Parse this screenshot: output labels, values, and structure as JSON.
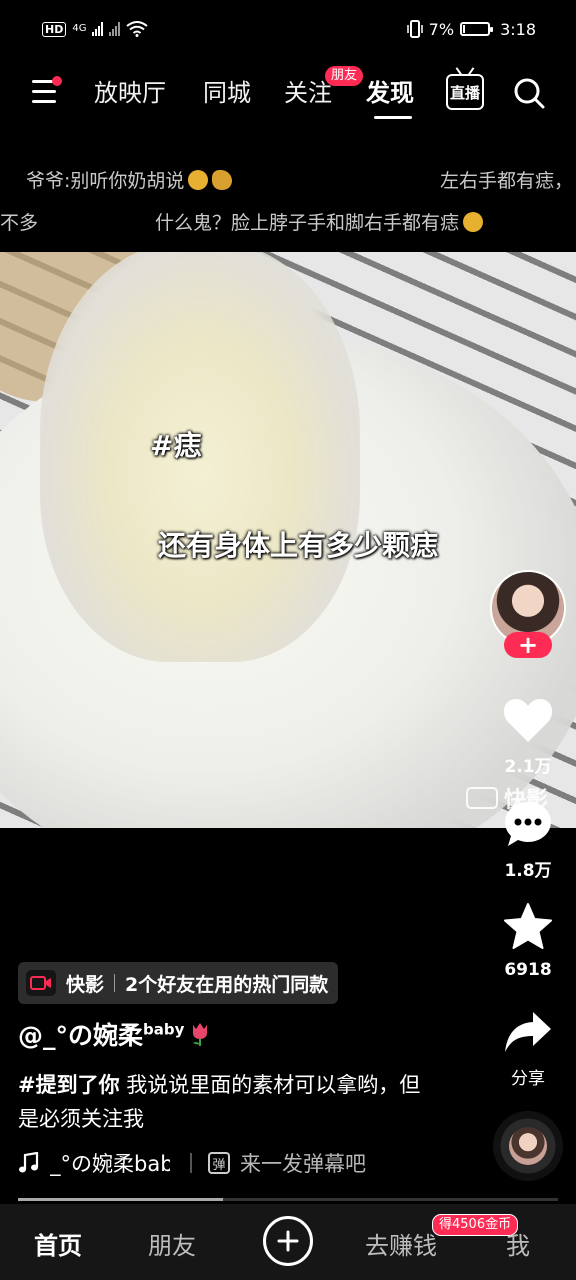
{
  "status_bar": {
    "network_badge": "HD",
    "network_type": "4G",
    "battery": "7%",
    "battery_level": 0.07,
    "time": "3:18"
  },
  "top_nav": {
    "tabs": [
      {
        "label": "放映厅",
        "active": false
      },
      {
        "label": "同城",
        "active": false
      },
      {
        "label": "关注",
        "active": false
      },
      {
        "label": "发现",
        "active": true
      }
    ],
    "friend_badge": "朋友",
    "live_label": "直播"
  },
  "danmaku": [
    {
      "text": "爷爷:别听你奶胡说"
    },
    {
      "text": "左右手都有痣，"
    },
    {
      "text": "不多"
    },
    {
      "text": "什么鬼？脸上脖子手和脚右手都有痣"
    }
  ],
  "video": {
    "hashtag_overlay": "#痣",
    "caption_overlay": "还有身体上有多少颗痣",
    "watermark": "快影"
  },
  "sidebar": {
    "likes": "2.1万",
    "comments": "1.8万",
    "favorites": "6918",
    "share_label": "分享"
  },
  "promo": {
    "app": "快影",
    "text": "2个好友在用的热门同款"
  },
  "author": {
    "name": "@_°の婉柔",
    "suffix": "baby"
  },
  "description": {
    "mention": "#提到了你",
    "text": " 我说说里面的素材可以拿哟，但是必须关注我"
  },
  "music": {
    "name": "_°の婉柔bab"
  },
  "danmaku_input": {
    "icon_label": "弹",
    "placeholder": "来一发弹幕吧"
  },
  "progress": {
    "fraction": 0.38
  },
  "tabbar": {
    "tabs": [
      {
        "label": "首页",
        "active": true
      },
      {
        "label": "朋友",
        "active": false
      },
      {
        "label": "去赚钱",
        "active": false
      },
      {
        "label": "我",
        "active": false
      }
    ],
    "coin_badge": "得4506金币"
  },
  "colors": {
    "accent": "#fe2c55",
    "background": "#000000",
    "tabbar": "#161616"
  }
}
